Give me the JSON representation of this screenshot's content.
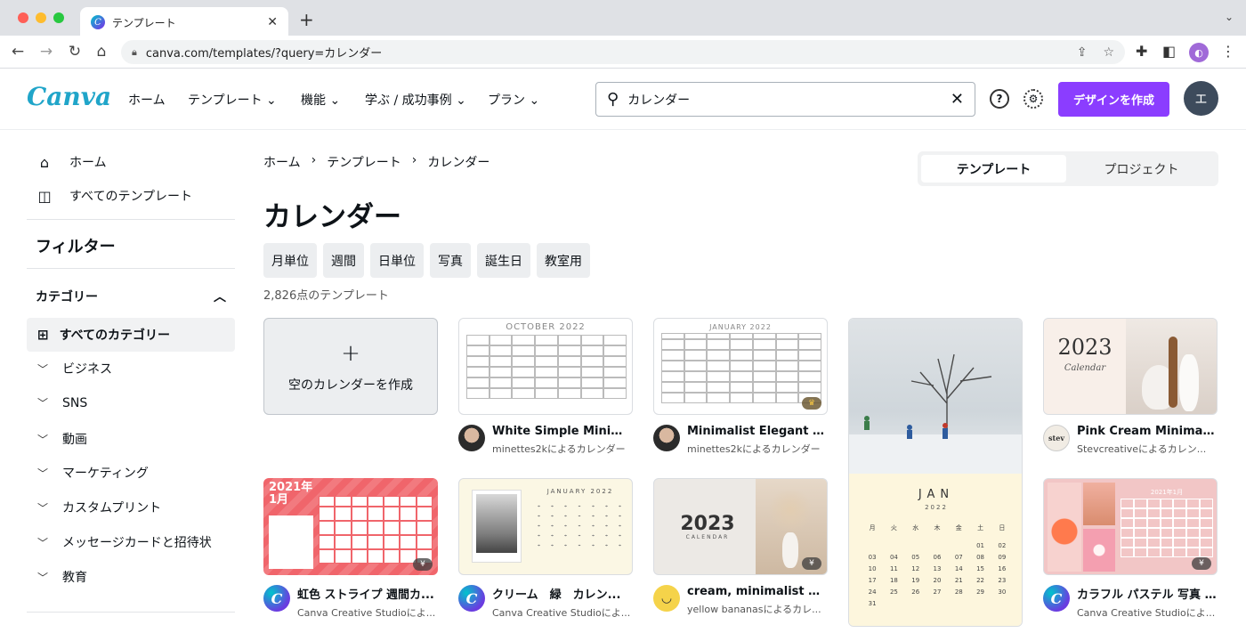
{
  "browser": {
    "tab_title": "テンプレート",
    "url": "canva.com/templates/?query=カレンダー"
  },
  "header": {
    "logo": "Canva",
    "nav": [
      "ホーム",
      "テンプレート",
      "機能",
      "学ぶ / 成功事例",
      "プラン"
    ],
    "search_value": "カレンダー",
    "create_label": "デザインを作成",
    "avatar_initial": "エ"
  },
  "sidebar": {
    "home": "ホーム",
    "all_templates": "すべてのテンプレート",
    "filter_title": "フィルター",
    "category_title": "カテゴリー",
    "selected_category": "すべてのカテゴリー",
    "categories": [
      "ビジネス",
      "SNS",
      "動画",
      "マーケティング",
      "カスタムプリント",
      "メッセージカードと招待状",
      "教育"
    ]
  },
  "breadcrumb": [
    "ホーム",
    "テンプレート",
    "カレンダー"
  ],
  "toggle": {
    "templates": "テンプレート",
    "projects": "プロジェクト"
  },
  "page_title": "カレンダー",
  "chips": [
    "月単位",
    "週間",
    "日単位",
    "写真",
    "誕生日",
    "教室用"
  ],
  "count": "2,826点のテンプレート",
  "blank_card": {
    "plus": "+",
    "label": "空のカレンダーを作成"
  },
  "cards": [
    {
      "title": "White Simple Minimal...",
      "sub": "minettes2kによるカレンダー",
      "thumb_title": "OCTOBER 2022"
    },
    {
      "title": "Minimalist Elegant 20...",
      "sub": "minettes2kによるカレンダー",
      "thumb_title": "JANUARY 2022"
    },
    {
      "title": "Pink Cream Minimalis...",
      "sub": "Stevcreativeによるカレン...",
      "thumb_title": "2023",
      "thumb_sub": "Calendar"
    },
    {
      "title": "虹色 ストライプ 週間カ...",
      "sub": "Canva Creative Studioによ...",
      "thumb_title": "2021年\n1月"
    },
    {
      "title": "クリーム　緑　カレン...",
      "sub": "Canva Creative Studioによ...",
      "thumb_title": "JANUARY 2022"
    },
    {
      "title": "cream, minimalist 202...",
      "sub": "yellow bananasによるカレ...",
      "thumb_title": "2023",
      "thumb_sub": "CALENDAR"
    },
    {
      "title": "カラフル パステル 写真 ...",
      "sub": "Canva Creative Studioによ...",
      "thumb_title": "2021年1月"
    }
  ],
  "tall_card": {
    "month": "JAN",
    "year": "2022",
    "weekdays": [
      "月",
      "火",
      "水",
      "木",
      "金",
      "土",
      "日"
    ],
    "days": [
      "",
      "",
      "",
      "",
      "",
      "01",
      "02",
      "03",
      "04",
      "05",
      "06",
      "07",
      "08",
      "09",
      "10",
      "11",
      "12",
      "13",
      "14",
      "15",
      "16",
      "17",
      "18",
      "19",
      "20",
      "21",
      "22",
      "23",
      "24",
      "25",
      "26",
      "27",
      "28",
      "29",
      "30",
      "31"
    ]
  },
  "badge": "¥",
  "colors": {
    "accent": "#8b3dff",
    "logo": "#20a5c9"
  }
}
